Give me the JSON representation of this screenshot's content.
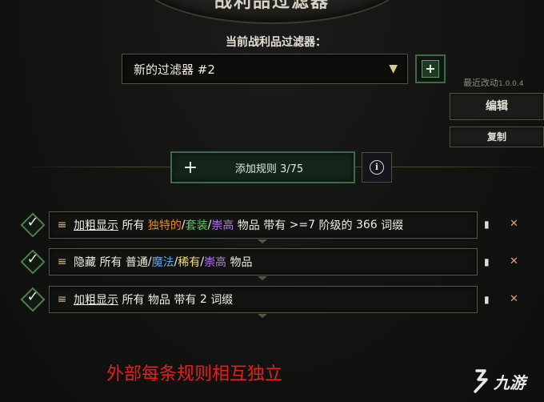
{
  "header": {
    "title": "战利品过滤器"
  },
  "filter": {
    "current_label": "当前战利品过滤器：",
    "selected": "新的过滤器 #2",
    "add_button": "+",
    "recent_label": "最近改动",
    "recent_version": "1.0.0.4",
    "edit_button": "编辑",
    "copy_button": "复制"
  },
  "toolbar": {
    "add_rule_plus": "+",
    "add_rule_label": "添加规则 3/75",
    "info_icon_glyph": "i"
  },
  "rules": [
    {
      "action": "加粗显示",
      "parts": [
        "所有",
        "独特的",
        "/",
        "套装",
        "/",
        "崇高",
        "物品",
        "带有",
        ">=7",
        "阶级的",
        "366",
        "词缀"
      ]
    },
    {
      "action": "隐藏",
      "parts": [
        "所有",
        "普通",
        "/",
        "魔法",
        "/",
        "稀有",
        "/",
        "崇高",
        "物品"
      ]
    },
    {
      "action": "加粗显示",
      "parts": [
        "所有",
        "物品",
        "带有",
        "2",
        "词缀"
      ]
    }
  ],
  "caption": "外部每条规则相互独立",
  "watermark": {
    "text": "九游"
  },
  "colors": {
    "unique": "#e0882c",
    "set": "#4fd44a",
    "exalted": "#b07ce8",
    "magic": "#5aa7f0",
    "rare": "#f0e05a",
    "caption": "#e21f1f",
    "accent_green": "#3c6b4a"
  },
  "icons": [
    "chevron-down-icon",
    "plus-icon",
    "info-icon",
    "checkmark-icon",
    "drag-handle-icon",
    "copy-icon",
    "close-icon"
  ]
}
